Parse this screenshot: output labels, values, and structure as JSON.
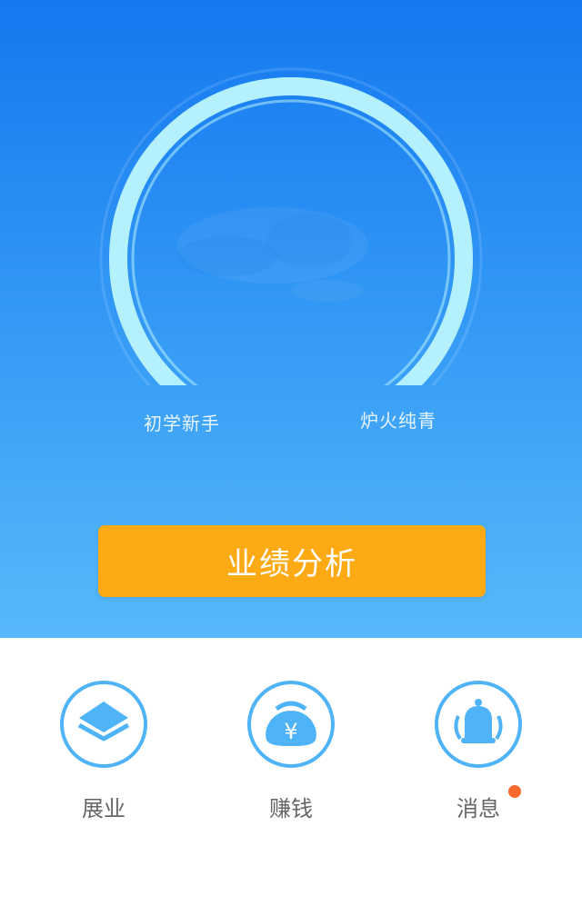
{
  "hero": {
    "level_left": "初学新手",
    "level_right": "炉火纯青",
    "cta_label": "业绩分析"
  },
  "nav": [
    {
      "label": "展业",
      "icon": "layers-icon"
    },
    {
      "label": "赚钱",
      "icon": "money-bag-icon"
    },
    {
      "label": "消息",
      "icon": "bell-icon",
      "badge": true
    }
  ],
  "colors": {
    "hero_top": "#1478f0",
    "hero_bottom": "#57b9fb",
    "cta": "#fdaa14",
    "nav_icon": "#4fb3f7",
    "badge": "#fb6a2c"
  }
}
